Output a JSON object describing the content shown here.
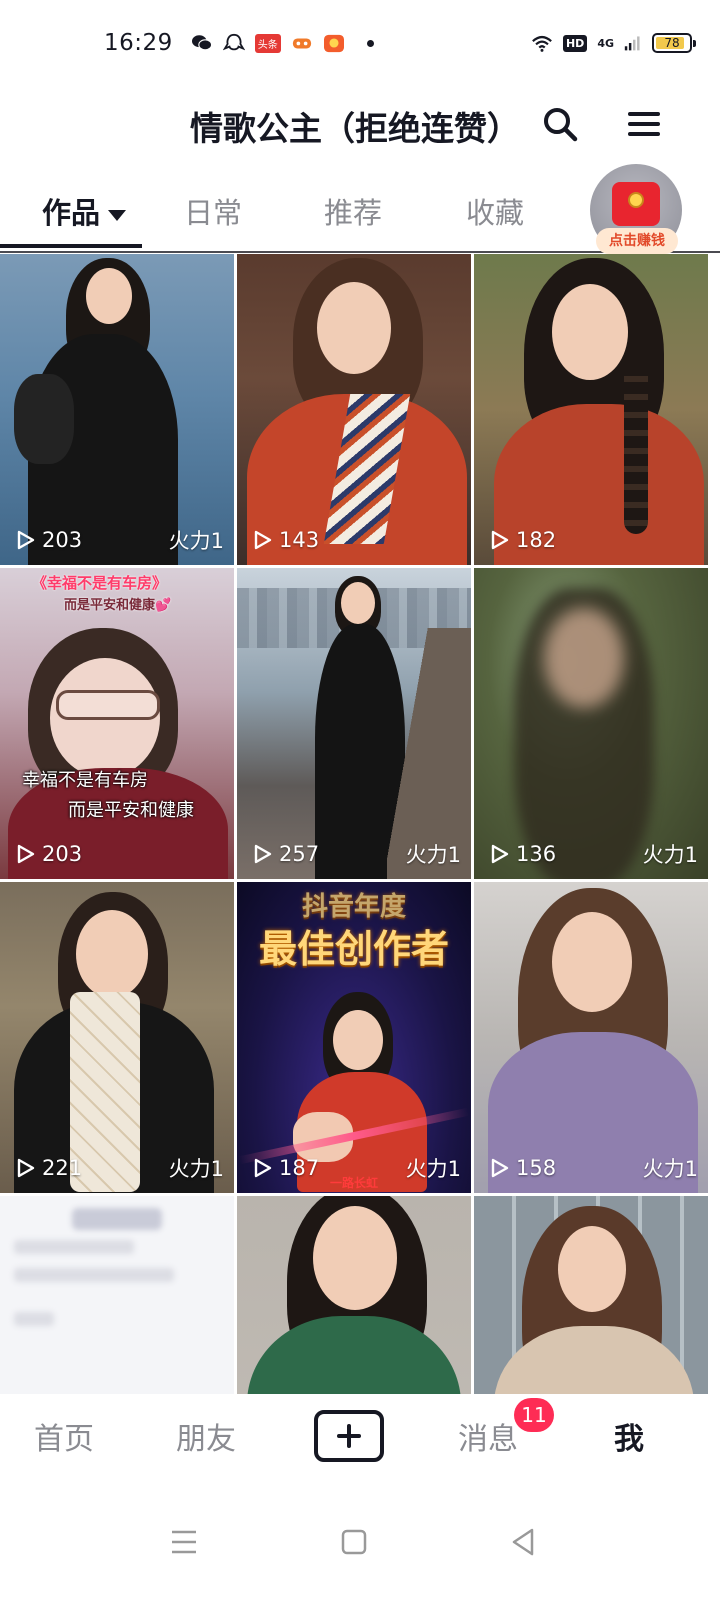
{
  "status_bar": {
    "time": "16:29",
    "app_badge": "头条",
    "network": "4G",
    "hd_label": "HD",
    "battery": "78"
  },
  "header": {
    "title": "情歌公主（拒绝连赞）"
  },
  "tabs": [
    {
      "label": "作品",
      "active": true
    },
    {
      "label": "日常",
      "active": false
    },
    {
      "label": "推荐",
      "active": false
    },
    {
      "label": "收藏",
      "active": false
    }
  ],
  "red_packet": {
    "label": "点击赚钱"
  },
  "videos": [
    {
      "plays": "203",
      "tag": "火力1"
    },
    {
      "plays": "143",
      "tag": ""
    },
    {
      "plays": "182",
      "tag": ""
    },
    {
      "plays": "203",
      "tag": "",
      "top_text": "《幸福不是有车房》",
      "top_text2": "而是平安和健康💕",
      "caption1": "幸福不是有车房",
      "caption2": "而是平安和健康"
    },
    {
      "plays": "257",
      "tag": "火力1"
    },
    {
      "plays": "136",
      "tag": "火力1"
    },
    {
      "plays": "221",
      "tag": "火力1"
    },
    {
      "plays": "187",
      "tag": "火力1",
      "award_line1": "抖音年度",
      "award_line2": "最佳创作者",
      "bottom_tag": "一路长虹"
    },
    {
      "plays": "158",
      "tag": "火力1"
    },
    {
      "plays": "",
      "tag": ""
    },
    {
      "plays": "",
      "tag": ""
    },
    {
      "plays": "",
      "tag": ""
    }
  ],
  "bottom_nav": {
    "home": "首页",
    "friends": "朋友",
    "messages": "消息",
    "messages_badge": "11",
    "me": "我"
  },
  "colors": {
    "accent_red": "#fe2c55",
    "text_primary": "#161823",
    "text_secondary": "#8a8b91"
  },
  "icons": [
    "wechat-icon",
    "qq-icon",
    "game-icon",
    "shop-icon",
    "wifi-icon",
    "signal-icon",
    "search-icon",
    "menu-icon",
    "play-icon",
    "plus-icon",
    "recent-apps-icon",
    "home-icon",
    "back-icon"
  ]
}
